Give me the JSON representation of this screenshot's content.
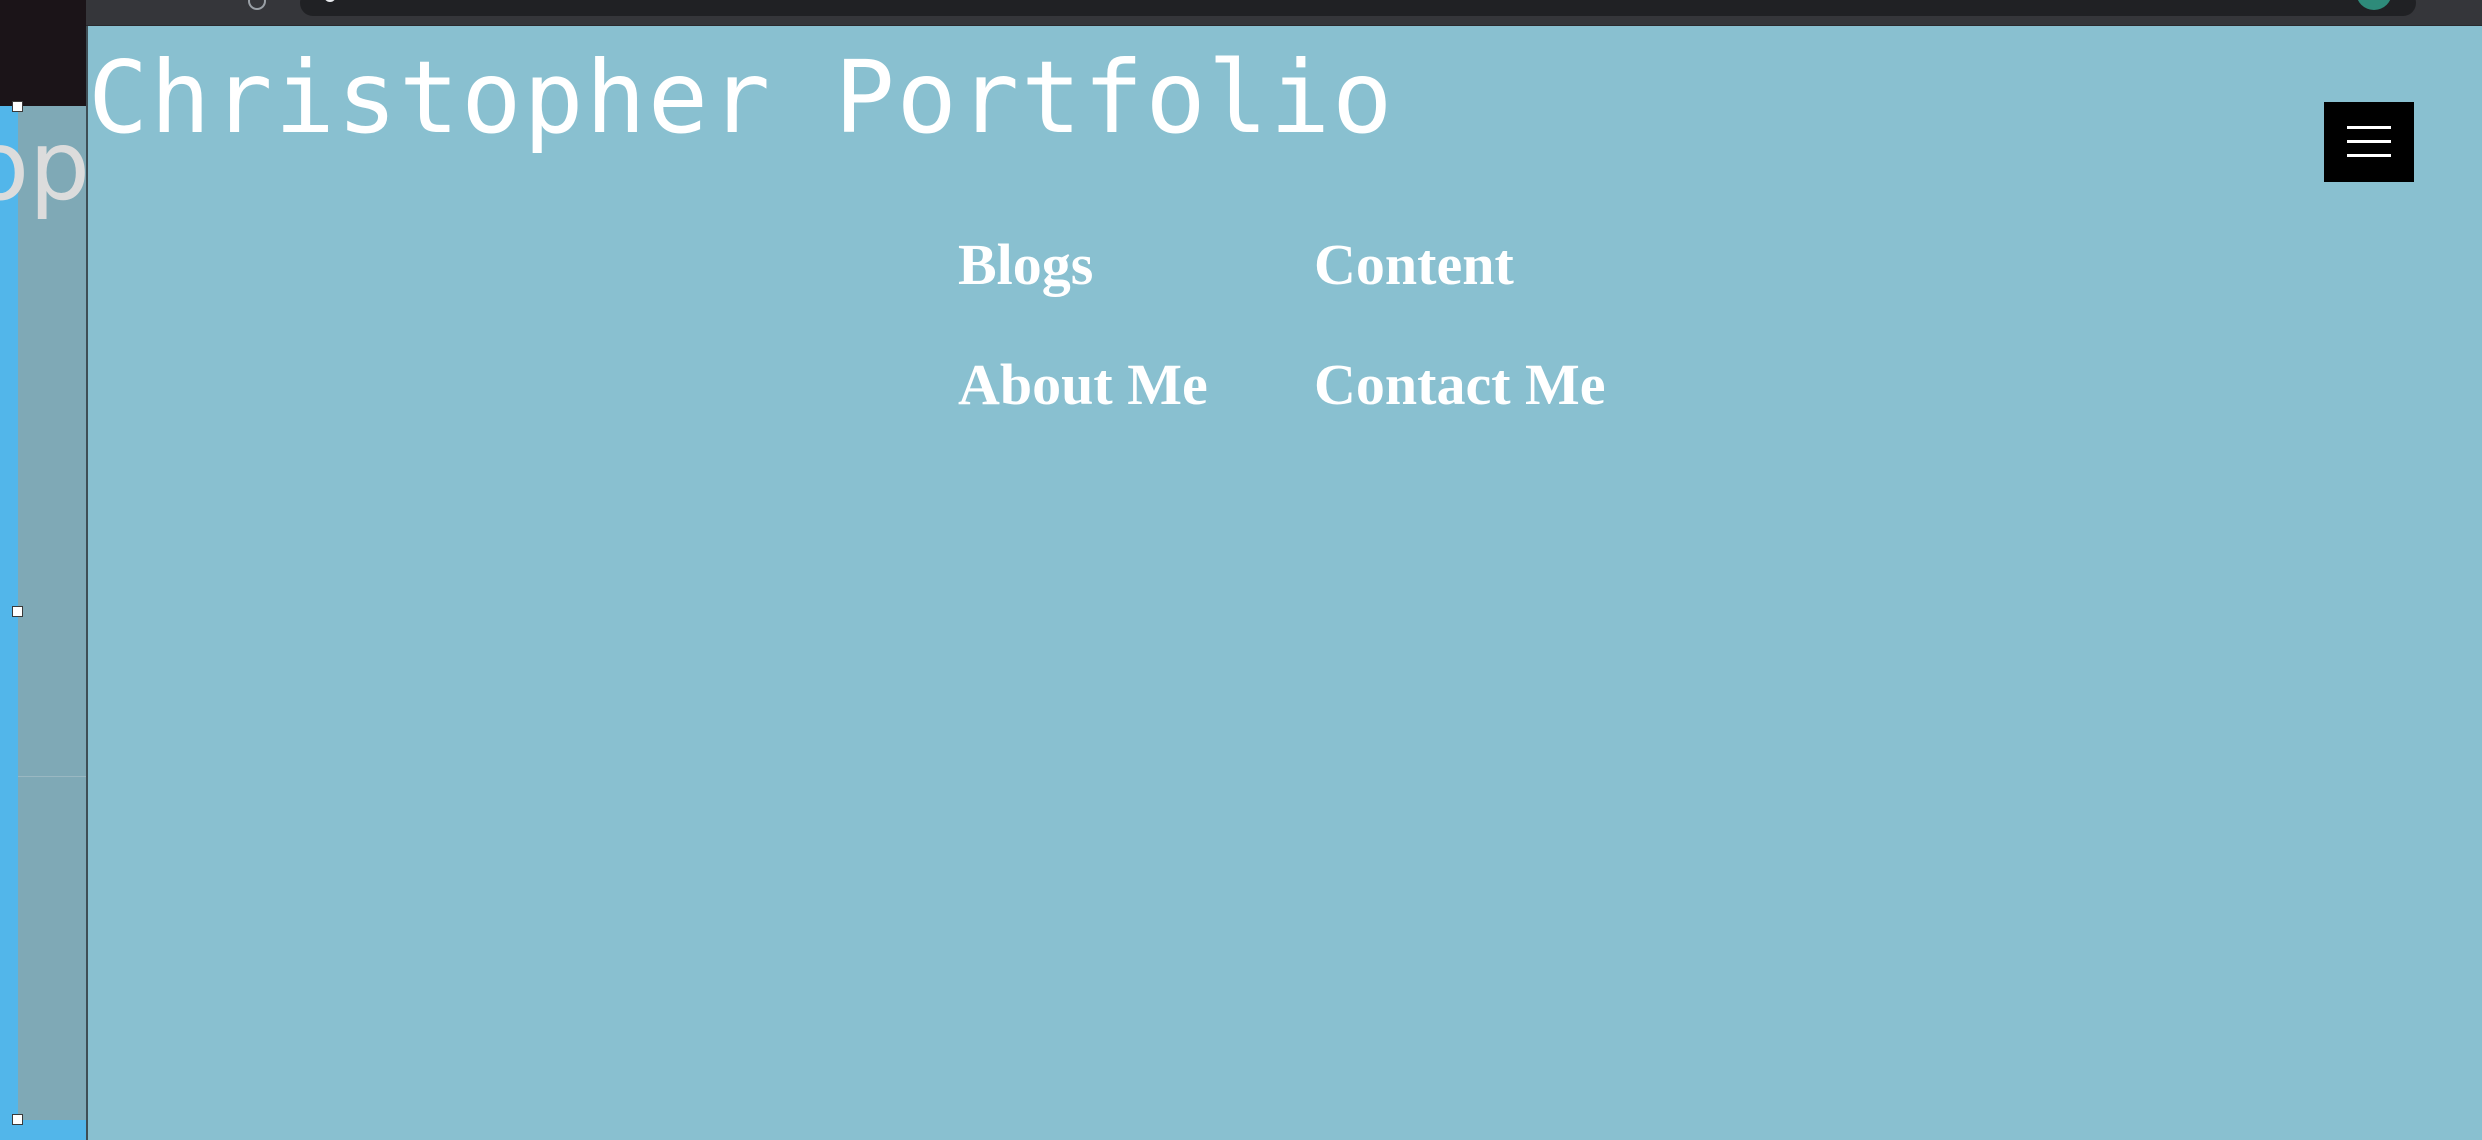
{
  "background_window": {
    "partial_title_text": "op"
  },
  "site": {
    "title": "Christopher Portfolio"
  },
  "menu_button": {
    "icon": "hamburger-menu-icon"
  },
  "nav": {
    "links": [
      {
        "label": "Blogs"
      },
      {
        "label": "Content"
      },
      {
        "label": "About Me"
      },
      {
        "label": "Contact Me"
      }
    ]
  },
  "colors": {
    "page_background": "#89c0d0",
    "title_text": "#ffffff",
    "menu_button_bg": "#000000",
    "nav_text": "#ffffff"
  }
}
